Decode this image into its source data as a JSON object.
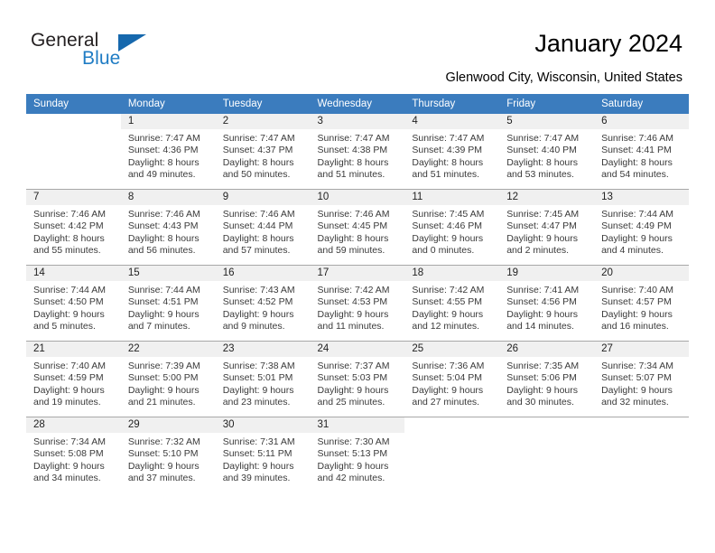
{
  "brand": {
    "line1": "General",
    "line2": "Blue",
    "triangle_color": "#1668ad",
    "blue_color": "#1f7cc4"
  },
  "header": {
    "title": "January 2024",
    "location": "Glenwood City, Wisconsin, United States"
  },
  "theme": {
    "header_row_bg": "#3b7cbe",
    "header_row_text": "#ffffff",
    "daynum_band_bg": "#f0f0f0",
    "grid_line": "#a8a8a8"
  },
  "weekday_headers": [
    "Sunday",
    "Monday",
    "Tuesday",
    "Wednesday",
    "Thursday",
    "Friday",
    "Saturday"
  ],
  "weeks": [
    [
      {
        "day": "",
        "sunrise": "",
        "sunset": "",
        "daylight1": "",
        "daylight2": ""
      },
      {
        "day": "1",
        "sunrise": "Sunrise: 7:47 AM",
        "sunset": "Sunset: 4:36 PM",
        "daylight1": "Daylight: 8 hours",
        "daylight2": "and 49 minutes."
      },
      {
        "day": "2",
        "sunrise": "Sunrise: 7:47 AM",
        "sunset": "Sunset: 4:37 PM",
        "daylight1": "Daylight: 8 hours",
        "daylight2": "and 50 minutes."
      },
      {
        "day": "3",
        "sunrise": "Sunrise: 7:47 AM",
        "sunset": "Sunset: 4:38 PM",
        "daylight1": "Daylight: 8 hours",
        "daylight2": "and 51 minutes."
      },
      {
        "day": "4",
        "sunrise": "Sunrise: 7:47 AM",
        "sunset": "Sunset: 4:39 PM",
        "daylight1": "Daylight: 8 hours",
        "daylight2": "and 51 minutes."
      },
      {
        "day": "5",
        "sunrise": "Sunrise: 7:47 AM",
        "sunset": "Sunset: 4:40 PM",
        "daylight1": "Daylight: 8 hours",
        "daylight2": "and 53 minutes."
      },
      {
        "day": "6",
        "sunrise": "Sunrise: 7:46 AM",
        "sunset": "Sunset: 4:41 PM",
        "daylight1": "Daylight: 8 hours",
        "daylight2": "and 54 minutes."
      }
    ],
    [
      {
        "day": "7",
        "sunrise": "Sunrise: 7:46 AM",
        "sunset": "Sunset: 4:42 PM",
        "daylight1": "Daylight: 8 hours",
        "daylight2": "and 55 minutes."
      },
      {
        "day": "8",
        "sunrise": "Sunrise: 7:46 AM",
        "sunset": "Sunset: 4:43 PM",
        "daylight1": "Daylight: 8 hours",
        "daylight2": "and 56 minutes."
      },
      {
        "day": "9",
        "sunrise": "Sunrise: 7:46 AM",
        "sunset": "Sunset: 4:44 PM",
        "daylight1": "Daylight: 8 hours",
        "daylight2": "and 57 minutes."
      },
      {
        "day": "10",
        "sunrise": "Sunrise: 7:46 AM",
        "sunset": "Sunset: 4:45 PM",
        "daylight1": "Daylight: 8 hours",
        "daylight2": "and 59 minutes."
      },
      {
        "day": "11",
        "sunrise": "Sunrise: 7:45 AM",
        "sunset": "Sunset: 4:46 PM",
        "daylight1": "Daylight: 9 hours",
        "daylight2": "and 0 minutes."
      },
      {
        "day": "12",
        "sunrise": "Sunrise: 7:45 AM",
        "sunset": "Sunset: 4:47 PM",
        "daylight1": "Daylight: 9 hours",
        "daylight2": "and 2 minutes."
      },
      {
        "day": "13",
        "sunrise": "Sunrise: 7:44 AM",
        "sunset": "Sunset: 4:49 PM",
        "daylight1": "Daylight: 9 hours",
        "daylight2": "and 4 minutes."
      }
    ],
    [
      {
        "day": "14",
        "sunrise": "Sunrise: 7:44 AM",
        "sunset": "Sunset: 4:50 PM",
        "daylight1": "Daylight: 9 hours",
        "daylight2": "and 5 minutes."
      },
      {
        "day": "15",
        "sunrise": "Sunrise: 7:44 AM",
        "sunset": "Sunset: 4:51 PM",
        "daylight1": "Daylight: 9 hours",
        "daylight2": "and 7 minutes."
      },
      {
        "day": "16",
        "sunrise": "Sunrise: 7:43 AM",
        "sunset": "Sunset: 4:52 PM",
        "daylight1": "Daylight: 9 hours",
        "daylight2": "and 9 minutes."
      },
      {
        "day": "17",
        "sunrise": "Sunrise: 7:42 AM",
        "sunset": "Sunset: 4:53 PM",
        "daylight1": "Daylight: 9 hours",
        "daylight2": "and 11 minutes."
      },
      {
        "day": "18",
        "sunrise": "Sunrise: 7:42 AM",
        "sunset": "Sunset: 4:55 PM",
        "daylight1": "Daylight: 9 hours",
        "daylight2": "and 12 minutes."
      },
      {
        "day": "19",
        "sunrise": "Sunrise: 7:41 AM",
        "sunset": "Sunset: 4:56 PM",
        "daylight1": "Daylight: 9 hours",
        "daylight2": "and 14 minutes."
      },
      {
        "day": "20",
        "sunrise": "Sunrise: 7:40 AM",
        "sunset": "Sunset: 4:57 PM",
        "daylight1": "Daylight: 9 hours",
        "daylight2": "and 16 minutes."
      }
    ],
    [
      {
        "day": "21",
        "sunrise": "Sunrise: 7:40 AM",
        "sunset": "Sunset: 4:59 PM",
        "daylight1": "Daylight: 9 hours",
        "daylight2": "and 19 minutes."
      },
      {
        "day": "22",
        "sunrise": "Sunrise: 7:39 AM",
        "sunset": "Sunset: 5:00 PM",
        "daylight1": "Daylight: 9 hours",
        "daylight2": "and 21 minutes."
      },
      {
        "day": "23",
        "sunrise": "Sunrise: 7:38 AM",
        "sunset": "Sunset: 5:01 PM",
        "daylight1": "Daylight: 9 hours",
        "daylight2": "and 23 minutes."
      },
      {
        "day": "24",
        "sunrise": "Sunrise: 7:37 AM",
        "sunset": "Sunset: 5:03 PM",
        "daylight1": "Daylight: 9 hours",
        "daylight2": "and 25 minutes."
      },
      {
        "day": "25",
        "sunrise": "Sunrise: 7:36 AM",
        "sunset": "Sunset: 5:04 PM",
        "daylight1": "Daylight: 9 hours",
        "daylight2": "and 27 minutes."
      },
      {
        "day": "26",
        "sunrise": "Sunrise: 7:35 AM",
        "sunset": "Sunset: 5:06 PM",
        "daylight1": "Daylight: 9 hours",
        "daylight2": "and 30 minutes."
      },
      {
        "day": "27",
        "sunrise": "Sunrise: 7:34 AM",
        "sunset": "Sunset: 5:07 PM",
        "daylight1": "Daylight: 9 hours",
        "daylight2": "and 32 minutes."
      }
    ],
    [
      {
        "day": "28",
        "sunrise": "Sunrise: 7:34 AM",
        "sunset": "Sunset: 5:08 PM",
        "daylight1": "Daylight: 9 hours",
        "daylight2": "and 34 minutes."
      },
      {
        "day": "29",
        "sunrise": "Sunrise: 7:32 AM",
        "sunset": "Sunset: 5:10 PM",
        "daylight1": "Daylight: 9 hours",
        "daylight2": "and 37 minutes."
      },
      {
        "day": "30",
        "sunrise": "Sunrise: 7:31 AM",
        "sunset": "Sunset: 5:11 PM",
        "daylight1": "Daylight: 9 hours",
        "daylight2": "and 39 minutes."
      },
      {
        "day": "31",
        "sunrise": "Sunrise: 7:30 AM",
        "sunset": "Sunset: 5:13 PM",
        "daylight1": "Daylight: 9 hours",
        "daylight2": "and 42 minutes."
      },
      {
        "day": "",
        "sunrise": "",
        "sunset": "",
        "daylight1": "",
        "daylight2": ""
      },
      {
        "day": "",
        "sunrise": "",
        "sunset": "",
        "daylight1": "",
        "daylight2": ""
      },
      {
        "day": "",
        "sunrise": "",
        "sunset": "",
        "daylight1": "",
        "daylight2": ""
      }
    ]
  ]
}
